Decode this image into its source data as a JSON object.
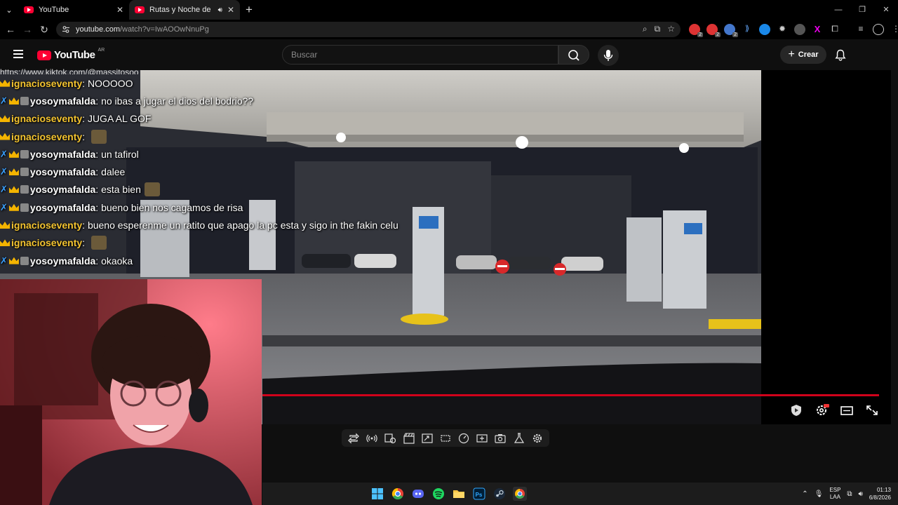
{
  "browser": {
    "tabs": [
      {
        "title": "YouTube",
        "active": false
      },
      {
        "title": "Rutas y Noche de Miércole",
        "active": true,
        "audio": true
      }
    ],
    "url_host": "youtube.com",
    "url_path": "/watch?v=IwAOOwNnuPg",
    "extension_badges": [
      "2",
      "2",
      "2"
    ]
  },
  "youtube": {
    "logo_text": "YouTube",
    "country": "AR",
    "search_placeholder": "Buscar",
    "create_label": "Crear"
  },
  "chat": {
    "partial_line": "https://www.kiktok.com/@massitosoo",
    "messages": [
      {
        "user": "ignacioseventy",
        "text": "NOOOOO",
        "badges": [
          "crown"
        ],
        "color": "#f4c430"
      },
      {
        "user": "yosoymafalda",
        "text": "no ibas a jugar el dios del bodrio??",
        "badges": [
          "sword",
          "crown",
          "pic"
        ],
        "color": "#ffffff"
      },
      {
        "user": "ignacioseventy",
        "text": "JUGA AL GOF",
        "badges": [
          "crown"
        ],
        "color": "#f4c430"
      },
      {
        "user": "ignacioseventy",
        "text": "",
        "badges": [
          "crown"
        ],
        "color": "#f4c430",
        "emote": true
      },
      {
        "user": "yosoymafalda",
        "text": "un tafirol",
        "badges": [
          "sword",
          "crown",
          "pic"
        ],
        "color": "#ffffff"
      },
      {
        "user": "yosoymafalda",
        "text": "dalee",
        "badges": [
          "sword",
          "crown",
          "pic"
        ],
        "color": "#ffffff"
      },
      {
        "user": "yosoymafalda",
        "text": "esta bien",
        "badges": [
          "sword",
          "crown",
          "pic"
        ],
        "color": "#ffffff",
        "emote": true
      },
      {
        "user": "yosoymafalda",
        "text": "bueno bien nos cagamos de risa",
        "badges": [
          "sword",
          "crown",
          "pic"
        ],
        "color": "#ffffff"
      },
      {
        "user": "ignacioseventy",
        "text": "bueno esperenme un ratito que apago la pc esta y sigo in the fakin celu",
        "badges": [
          "crown"
        ],
        "color": "#f4c430"
      },
      {
        "user": "ignacioseventy",
        "text": "",
        "badges": [
          "crown"
        ],
        "color": "#f4c430",
        "emote": true
      },
      {
        "user": "yosoymafalda",
        "text": "okaoka",
        "badges": [
          "sword",
          "crown",
          "pic"
        ],
        "color": "#ffffff"
      }
    ]
  },
  "player": {
    "progress_fraction": 0.99
  },
  "taskbar": {
    "lang_top": "ESP",
    "lang_bottom": "LAA",
    "time": "01:13",
    "date": "6/8/2026"
  },
  "colors": {
    "accent": "#ff0033",
    "progress": "#d0021b",
    "chat_user_gold": "#f4c430"
  }
}
